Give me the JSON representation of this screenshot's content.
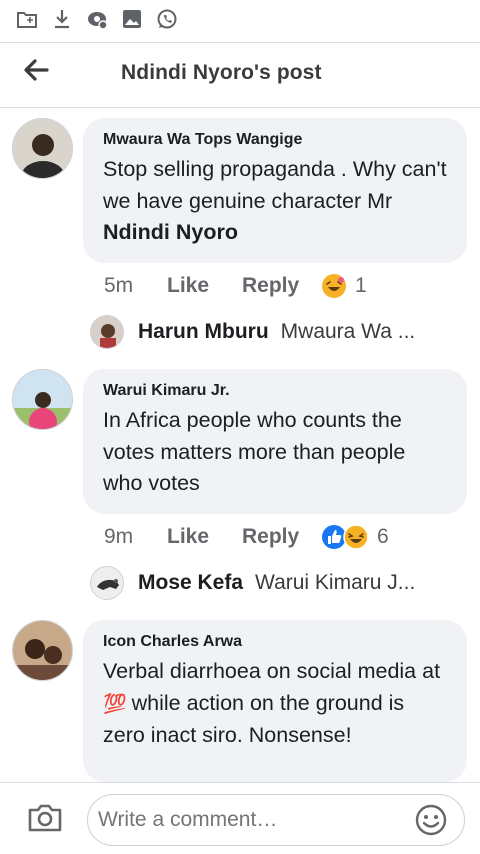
{
  "status_bar": {
    "icons": [
      "folder-icon",
      "download-icon",
      "eye-settings-icon",
      "image-icon",
      "whatsapp-icon"
    ]
  },
  "header": {
    "title": "Ndindi Nyoro's post",
    "back_icon": "arrow-left-icon"
  },
  "comments": [
    {
      "author": "Mwaura Wa Tops Wangige",
      "text": "Stop selling propaganda . Why can't we have genuine character Mr ",
      "mention": "Ndindi Nyoro",
      "time": "5m",
      "like_label": "Like",
      "reply_label": "Reply",
      "reactions": [
        "haha-icon"
      ],
      "reaction_count": "1",
      "reply_preview": {
        "name": "Harun Mburu",
        "text": "Mwaura Wa ..."
      }
    },
    {
      "author": "Warui Kimaru Jr.",
      "text": "In Africa people who counts the votes matters more than people who votes",
      "time": "9m",
      "like_label": "Like",
      "reply_label": "Reply",
      "reactions": [
        "like-icon",
        "haha-icon"
      ],
      "reaction_count": "6",
      "reply_preview": {
        "name": "Mose Kefa",
        "text": "Warui Kimaru J..."
      }
    },
    {
      "author": "Icon Charles Arwa",
      "text_before": "Verbal diarrhoea on social media at ",
      "emoji": "💯",
      "text_after": " while action on the ground is zero inact siro. Nonsense!"
    }
  ],
  "composer": {
    "placeholder": "Write a comment…"
  },
  "colors": {
    "bubble": "#f0f2f5",
    "meta_text": "#65676b",
    "like_blue": "#1877f2",
    "haha_yellow": "#f7b125"
  }
}
